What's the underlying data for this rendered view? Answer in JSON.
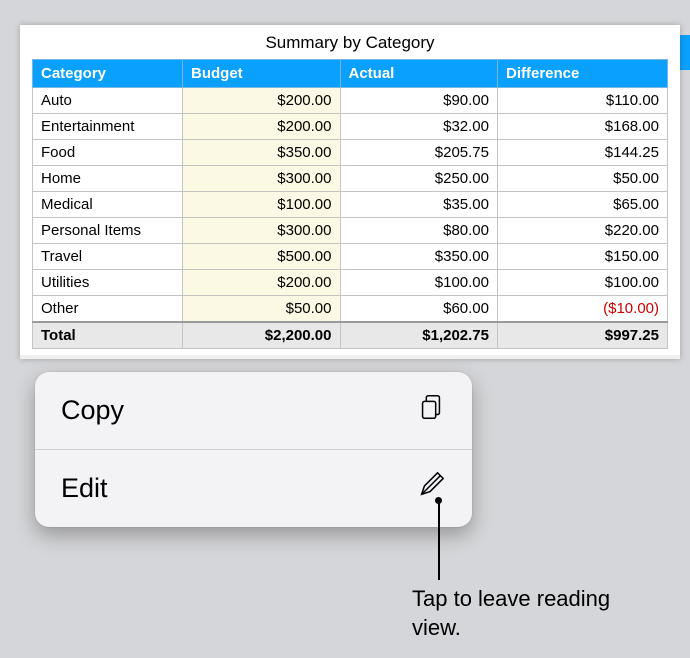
{
  "sheet": {
    "title": "Summary by Category",
    "headers": [
      "Category",
      "Budget",
      "Actual",
      "Difference"
    ],
    "rows": [
      {
        "category": "Auto",
        "budget": "$200.00",
        "actual": "$90.00",
        "diff": "$110.00",
        "neg": false
      },
      {
        "category": "Entertainment",
        "budget": "$200.00",
        "actual": "$32.00",
        "diff": "$168.00",
        "neg": false
      },
      {
        "category": "Food",
        "budget": "$350.00",
        "actual": "$205.75",
        "diff": "$144.25",
        "neg": false
      },
      {
        "category": "Home",
        "budget": "$300.00",
        "actual": "$250.00",
        "diff": "$50.00",
        "neg": false
      },
      {
        "category": "Medical",
        "budget": "$100.00",
        "actual": "$35.00",
        "diff": "$65.00",
        "neg": false
      },
      {
        "category": "Personal Items",
        "budget": "$300.00",
        "actual": "$80.00",
        "diff": "$220.00",
        "neg": false
      },
      {
        "category": "Travel",
        "budget": "$500.00",
        "actual": "$350.00",
        "diff": "$150.00",
        "neg": false
      },
      {
        "category": "Utilities",
        "budget": "$200.00",
        "actual": "$100.00",
        "diff": "$100.00",
        "neg": false
      },
      {
        "category": "Other",
        "budget": "$50.00",
        "actual": "$60.00",
        "diff": "($10.00)",
        "neg": true
      }
    ],
    "total": {
      "label": "Total",
      "budget": "$2,200.00",
      "actual": "$1,202.75",
      "diff": "$997.25"
    }
  },
  "menu": {
    "copy": "Copy",
    "edit": "Edit"
  },
  "callout": "Tap to leave reading view."
}
